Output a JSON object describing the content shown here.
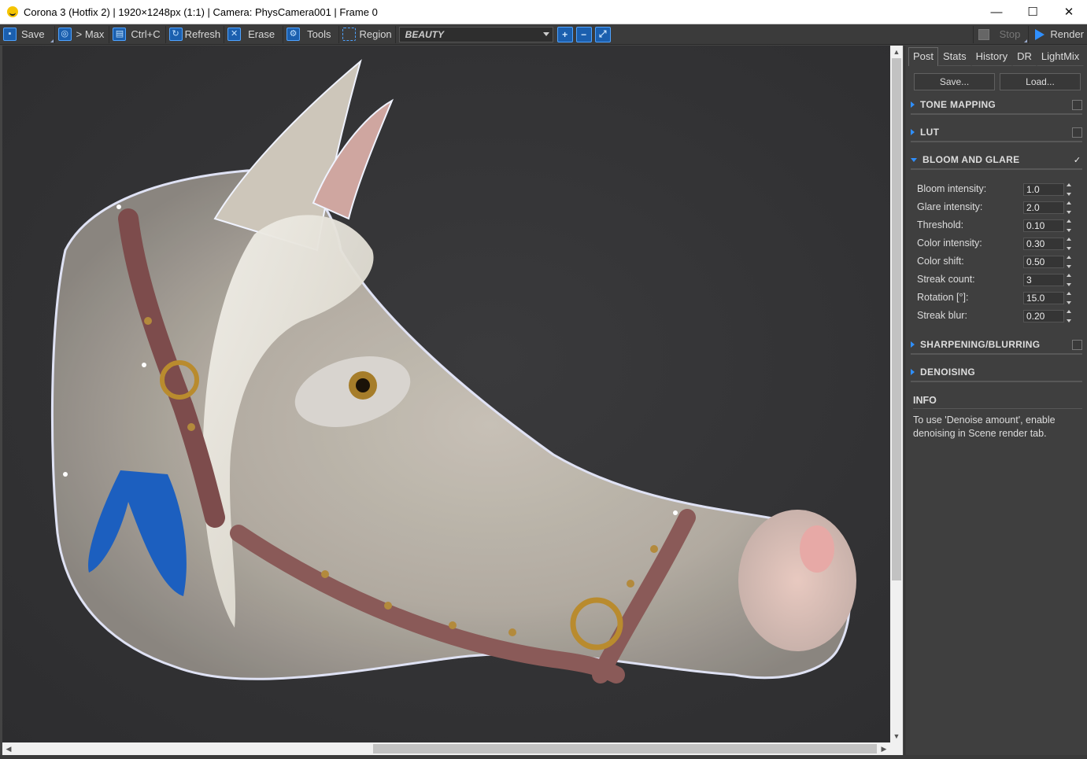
{
  "window": {
    "title": "Corona 3 (Hotfix 2) | 1920×1248px (1:1) | Camera: PhysCamera001 | Frame 0",
    "minimize": "—",
    "maximize": "☐",
    "close": "✕"
  },
  "toolbar": {
    "save": "Save",
    "max": "> Max",
    "copy": "Ctrl+C",
    "refresh": "Refresh",
    "erase": "Erase",
    "tools": "Tools",
    "region": "Region",
    "pass": "BEAUTY",
    "zoom_in": "+",
    "zoom_out": "−",
    "zoom_fit": "⤢",
    "stop": "Stop",
    "render": "Render"
  },
  "panel": {
    "tabs": [
      "Post",
      "Stats",
      "History",
      "DR",
      "LightMix"
    ],
    "active_tab": "Post",
    "save_btn": "Save...",
    "load_btn": "Load...",
    "sections": {
      "tone_mapping": "TONE MAPPING",
      "lut": "LUT",
      "bloom_glare": "BLOOM AND GLARE",
      "sharpening": "SHARPENING/BLURRING",
      "denoising": "DENOISING"
    },
    "bloom_checked": "✓",
    "params": [
      {
        "label": "Bloom intensity:",
        "value": "1.0"
      },
      {
        "label": "Glare intensity:",
        "value": "2.0"
      },
      {
        "label": "Threshold:",
        "value": "0.10"
      },
      {
        "label": "Color intensity:",
        "value": "0.30"
      },
      {
        "label": "Color shift:",
        "value": "0.50"
      },
      {
        "label": "Streak count:",
        "value": "3"
      },
      {
        "label": "Rotation [°]:",
        "value": "15.0"
      },
      {
        "label": "Streak blur:",
        "value": "0.20"
      }
    ],
    "info_title": "INFO",
    "info_text": "To use 'Denoise amount', enable denoising in Scene render tab."
  }
}
